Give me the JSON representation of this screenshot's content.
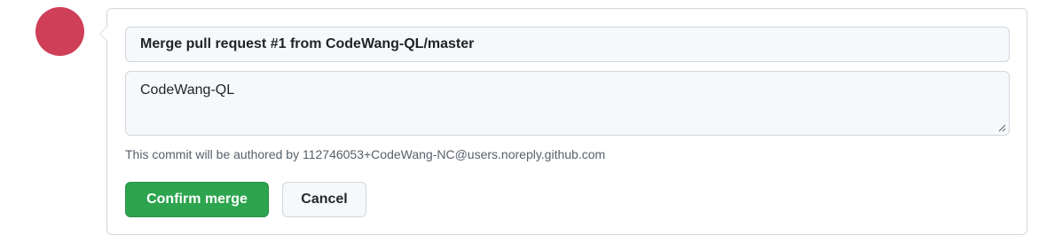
{
  "avatar": {
    "color": "#cf3f58"
  },
  "merge_form": {
    "title_value": "Merge pull request #1 from CodeWang-QL/master",
    "body_value": "CodeWang-QL",
    "author_note": "This commit will be authored by 112746053+CodeWang-NC@users.noreply.github.com",
    "confirm_label": "Confirm merge",
    "cancel_label": "Cancel"
  },
  "colors": {
    "confirm_button": "#2da44e",
    "border": "#d0d7de",
    "input_background": "#f6f8fa"
  }
}
